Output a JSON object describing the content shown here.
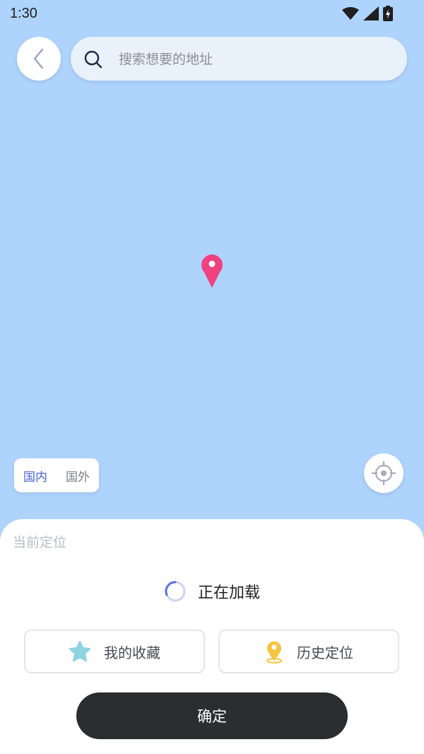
{
  "status_bar": {
    "time": "1:30"
  },
  "search": {
    "placeholder": "搜索想要的地址"
  },
  "region_toggle": {
    "domestic": "国内",
    "overseas": "国外"
  },
  "bottom_sheet": {
    "title": "当前定位",
    "loading_text": "正在加载",
    "favorites_label": "我的收藏",
    "history_label": "历史定位",
    "confirm_label": "确定"
  },
  "colors": {
    "map_background": "#aed4fe",
    "pin": "#f0427f",
    "accent": "#4a63d6",
    "star": "#8fd3e0",
    "history_pin": "#f5c542",
    "confirm_button": "#2b2d2f"
  },
  "icons": {
    "back": "chevron-left-icon",
    "search": "search-icon",
    "map_pin": "map-pin-icon",
    "locate": "crosshair-icon",
    "loading": "spinner-icon",
    "favorites": "star-icon",
    "history": "location-pin-icon"
  }
}
